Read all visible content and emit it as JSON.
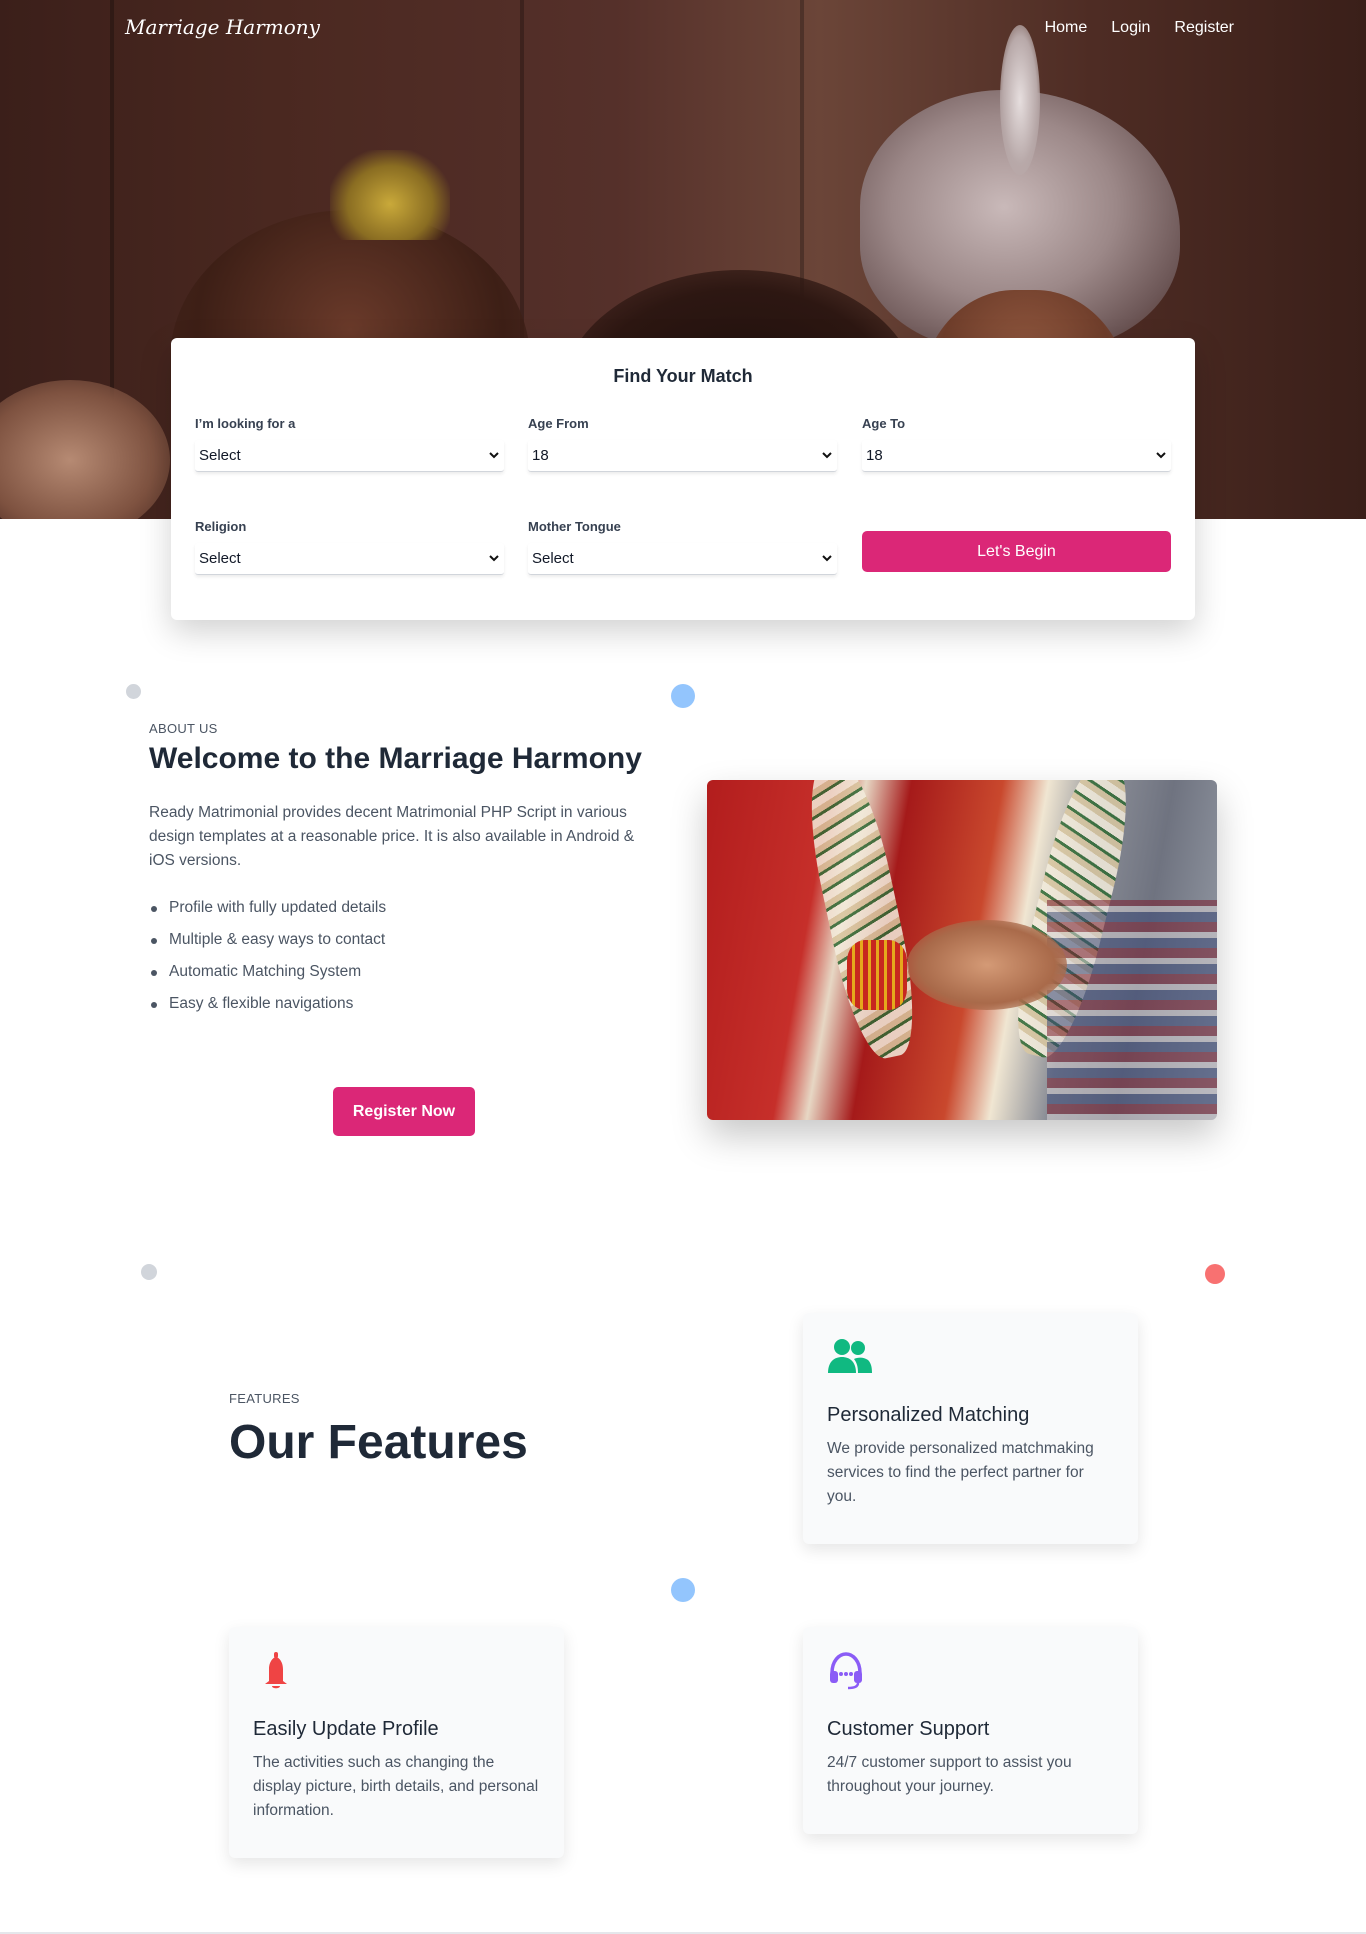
{
  "brand": "Marriage Harmony",
  "nav": {
    "home": "Home",
    "login": "Login",
    "register": "Register"
  },
  "search": {
    "title": "Find Your Match",
    "looking_for": {
      "label": "I’m looking for a",
      "value": "Select"
    },
    "age_from": {
      "label": "Age From",
      "value": "18"
    },
    "age_to": {
      "label": "Age To",
      "value": "18"
    },
    "religion": {
      "label": "Religion",
      "value": "Select"
    },
    "mother_tongue": {
      "label": "Mother Tongue",
      "value": "Select"
    },
    "submit_label": "Let's Begin"
  },
  "about": {
    "kicker": "ABOUT US",
    "title": "Welcome to the Marriage Harmony",
    "text": "Ready Matrimonial provides decent Matrimonial PHP Script in various design templates at a reasonable price. It is also available in Android & iOS versions.",
    "items": [
      "Profile with fully updated details",
      "Multiple & easy ways to contact",
      "Automatic Matching System",
      "Easy & flexible navigations"
    ],
    "button_label": "Register Now"
  },
  "features": {
    "kicker": "FEATURES",
    "title": "Our Features",
    "cards": [
      {
        "icon": "users-icon",
        "color": "#10b981",
        "title": "Personalized Matching",
        "text": "We provide personalized matchmaking services to find the perfect partner for you."
      },
      {
        "icon": "bell-icon",
        "color": "#ef4444",
        "title": "Easily Update Profile",
        "text": "The activities such as changing the display picture, birth details, and personal information."
      },
      {
        "icon": "headset-icon",
        "color": "#8b5cf6",
        "title": "Customer Support",
        "text": "24/7 customer support to assist you throughout your journey."
      }
    ]
  },
  "colors": {
    "accent": "#db2777",
    "dot_blue": "#93c5fd",
    "dot_gray": "#d1d5db",
    "dot_red": "#f87171"
  }
}
